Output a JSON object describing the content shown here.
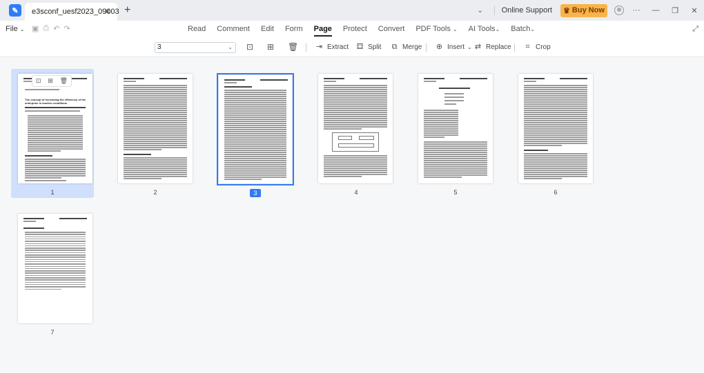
{
  "titlebar": {
    "tab_title": "e3sconf_uesf2023_09003",
    "online_support": "Online Support",
    "buy_now": "Buy Now"
  },
  "menubar": {
    "file": "File",
    "items": [
      "Read",
      "Comment",
      "Edit",
      "Form",
      "Page",
      "Protect",
      "Convert",
      "PDF Tools",
      "AI Tools",
      "Batch"
    ],
    "active": "Page"
  },
  "toolbar": {
    "page_input_value": "3",
    "extract": "Extract",
    "split": "Split",
    "merge": "Merge",
    "insert": "Insert",
    "replace": "Replace",
    "crop": "Crop"
  },
  "pages": [
    {
      "number": "1",
      "selected": true
    },
    {
      "number": "2",
      "selected": false
    },
    {
      "number": "3",
      "selected": false,
      "current": true
    },
    {
      "number": "4",
      "selected": false
    },
    {
      "number": "5",
      "selected": false
    },
    {
      "number": "6",
      "selected": false
    },
    {
      "number": "7",
      "selected": false
    }
  ],
  "page1_heading": "The concept of increasing the efficiency of the enterprise in modern conditions",
  "colors": {
    "accent": "#2f7cf6",
    "selection": "#cfdffc",
    "buy_now": "#f8b44a"
  }
}
